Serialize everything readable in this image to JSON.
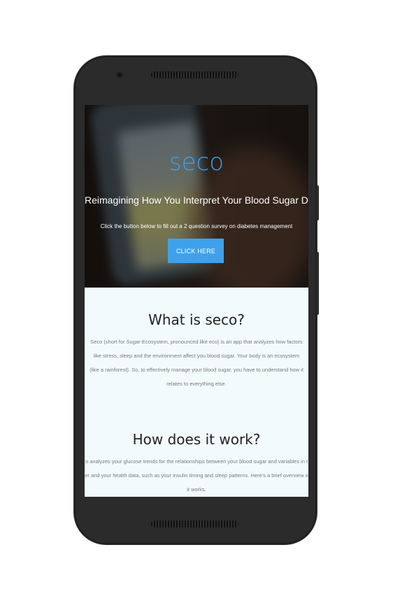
{
  "hero": {
    "brand": "seco",
    "tagline": "Reimagining How You Interpret Your Blood Sugar Data",
    "subtext": "Click the button below to fill out a 2 question survey on diabetes management",
    "button_label": "CLICK HERE"
  },
  "section_what": {
    "heading": "What is seco?",
    "body": "Seco (short for Sugar-Ecosystem, pronounced like eco) is an app that analyzes how factors like stress, sleep and the environment affect you blood sugar. Your body is an ecosystem (like a rainforest). So, to effectively manage your blood sugar, you have to understand how it relates to everything else."
  },
  "section_how": {
    "heading": "How does it work?",
    "line1": "o analyzes your glucose trends for the relationships between your blood sugar and variables in t",
    "line2": "er and your health data, such as your insulin timing and sleep patterns. Here's a brief overview o",
    "line3": "it works."
  },
  "colors": {
    "accent": "#3fa1ec",
    "brand": "#3ea0ea",
    "device": "#2b2b2b",
    "section_bg": "#f3fafb"
  }
}
